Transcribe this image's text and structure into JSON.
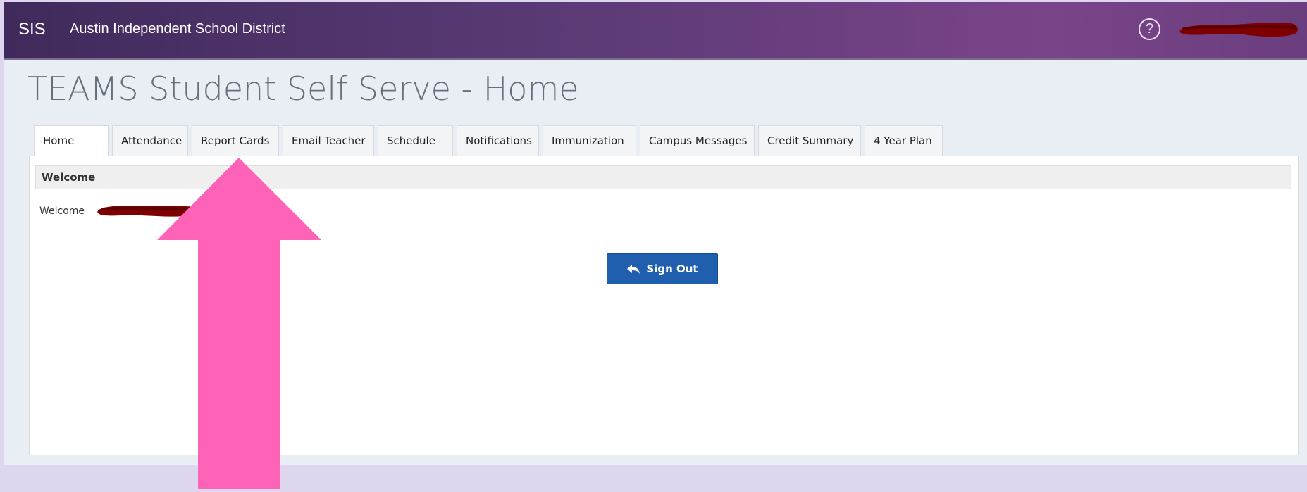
{
  "header": {
    "brand": "SIS",
    "district": "Austin Independent School District",
    "help_symbol": "?",
    "help_icon": "question-circle-icon",
    "user_name_redacted": true
  },
  "page": {
    "title": "TEAMS Student Self Serve - Home"
  },
  "tabs": [
    {
      "label": "Home",
      "active": true
    },
    {
      "label": "Attendance",
      "active": false
    },
    {
      "label": "Report Cards",
      "active": false
    },
    {
      "label": "Email Teacher",
      "active": false
    },
    {
      "label": "Schedule",
      "active": false
    },
    {
      "label": "Notifications",
      "active": false
    },
    {
      "label": "Immunization",
      "active": false
    },
    {
      "label": "Campus Messages",
      "active": false
    },
    {
      "label": "Credit Summary",
      "active": false
    },
    {
      "label": "4 Year Plan",
      "active": false
    }
  ],
  "panel": {
    "section_title": "Welcome",
    "welcome_text": "Welcome",
    "welcome_name_redacted": true,
    "signout_label": "Sign Out",
    "signout_icon": "reply-arrow-icon"
  },
  "overlay": {
    "arrow_color": "#ff63b8",
    "arrow_icon": "up-arrow-annotation"
  },
  "colors": {
    "header_start": "#3f2a5b",
    "header_end": "#7a4488",
    "signout_button": "#1f5fae",
    "redaction": "#7f0000"
  }
}
